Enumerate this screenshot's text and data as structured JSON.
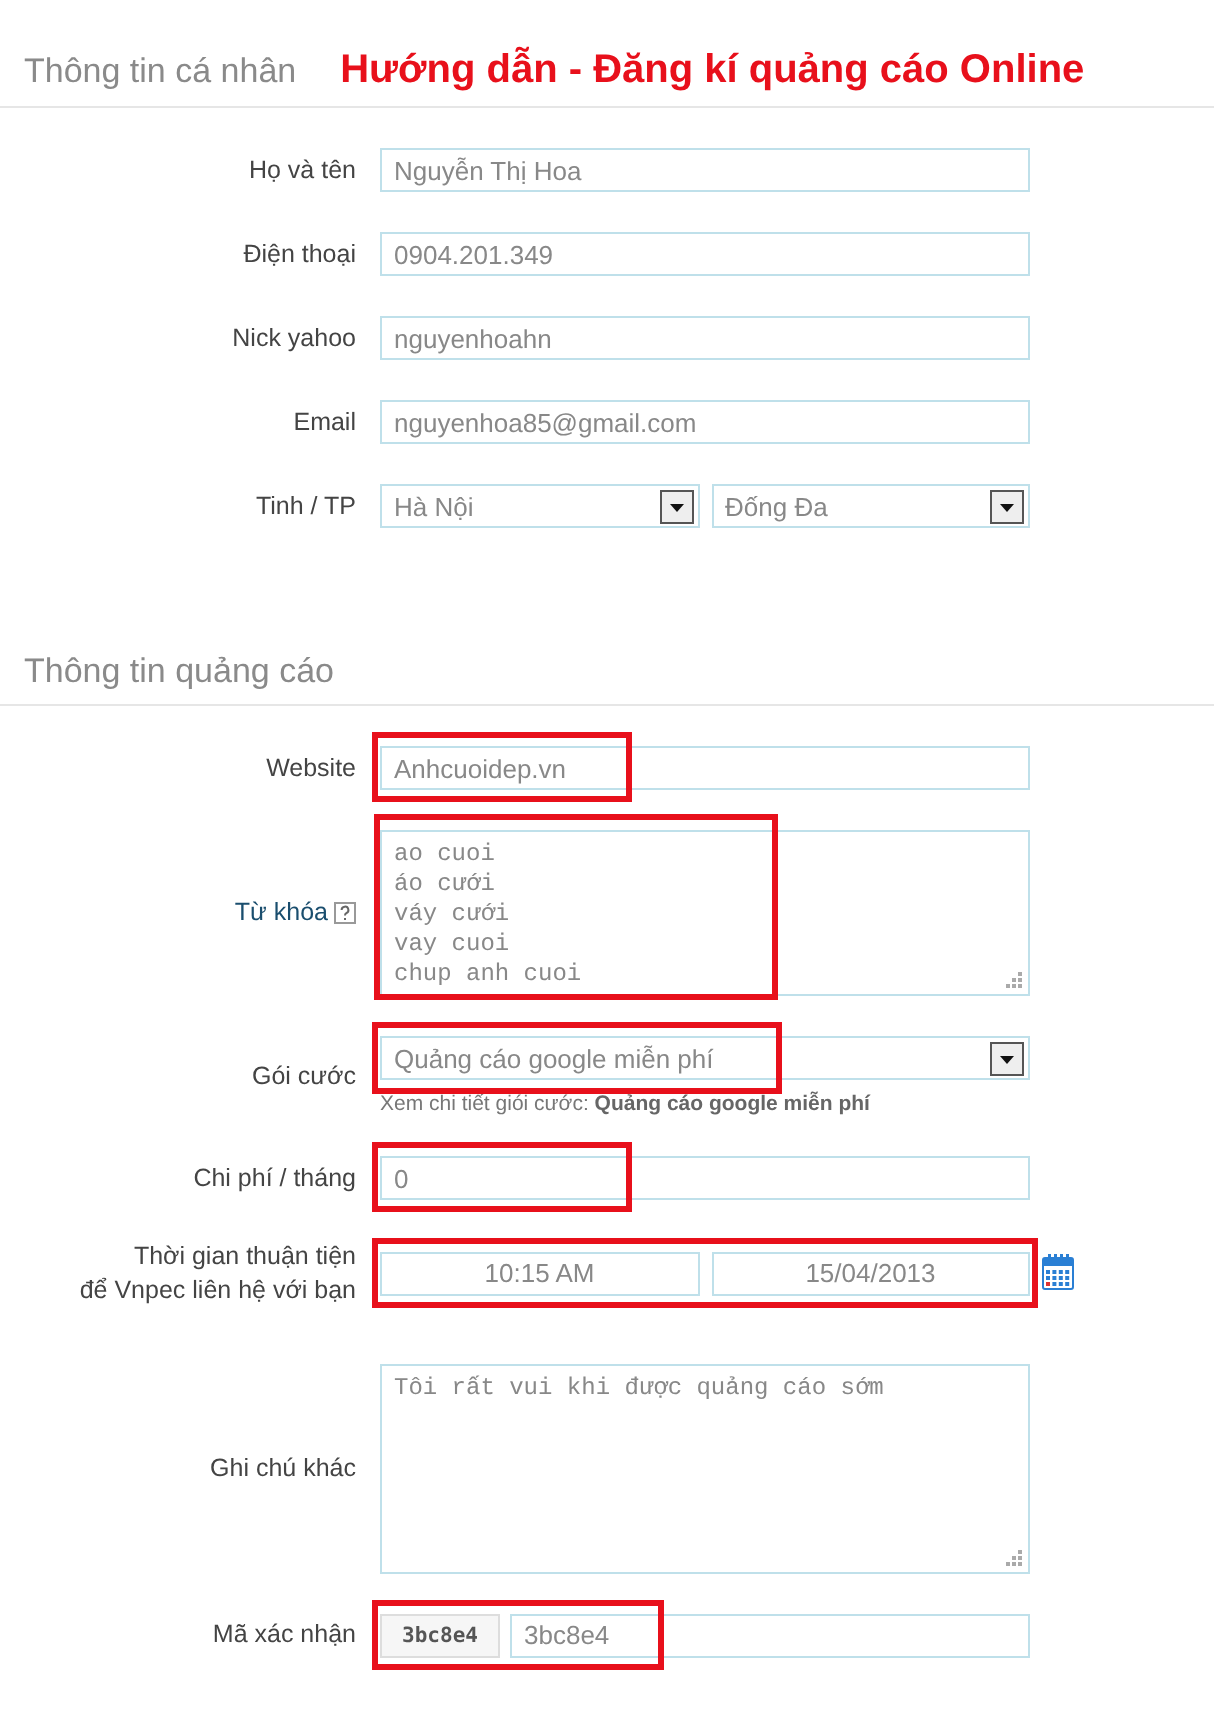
{
  "title": "Hướng dẫn - Đăng kí quảng cáo Online",
  "sections": [
    {
      "heading": "Thông tin cá nhân",
      "rows": [
        {
          "kind": "text",
          "label": "Họ và tên",
          "value": "Nguyễn Thị Hoa"
        },
        {
          "kind": "text",
          "label": "Điện thoại",
          "value": "0904.201.349"
        },
        {
          "kind": "text",
          "label": "Nick yahoo",
          "value": "nguyenhoahn"
        },
        {
          "kind": "text",
          "label": "Email",
          "value": "nguyenhoa85@gmail.com"
        },
        {
          "kind": "selects",
          "label": "Tinh / TP",
          "values": [
            "Hà Nội",
            "Đống Đa"
          ]
        }
      ]
    },
    {
      "heading": "Thông tin quảng cáo",
      "rows": [
        {
          "kind": "text",
          "label": "Website",
          "value": "Anhcuoidep.vn",
          "highlighted": true
        },
        {
          "kind": "textarea",
          "label": "Từ khóa",
          "help": true,
          "value": "ao cuoi\náo cưới\nváy cưới\nvay cuoi\nchup anh cuoi",
          "highlighted": true
        },
        {
          "kind": "select",
          "label": "Gói cước",
          "value": "Quảng cáo google miễn phí",
          "hint": "Xem chi tiết giói cước: **Quảng cáo google miễn phí**",
          "highlighted": true
        },
        {
          "kind": "text",
          "label": "Chi phí / tháng",
          "value": "0",
          "highlighted": true
        },
        {
          "kind": "time",
          "label": "Thời gian thuận tiện\nđể Vnpec liên hệ với bạn",
          "values": [
            "10:15 AM",
            "15/04/2013"
          ],
          "calendar": true,
          "highlighted": true
        },
        {
          "kind": "note",
          "label": "Ghi chú khác",
          "value": "Tôi rất vui khi được quảng cáo sớm"
        },
        {
          "kind": "captcha",
          "label": "Mã xác nhận",
          "code": "3bc8e4",
          "value": "3bc8e4",
          "highlighted": true
        }
      ]
    }
  ]
}
